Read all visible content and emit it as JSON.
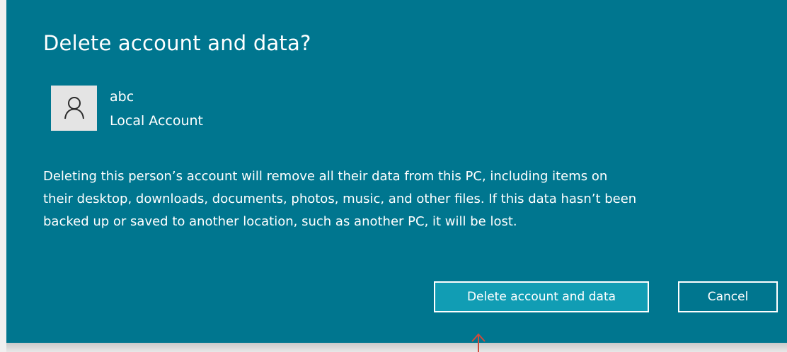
{
  "dialog": {
    "title": "Delete account and data?",
    "account": {
      "name": "abc",
      "type": "Local Account",
      "avatar_icon": "person-icon"
    },
    "message_lines": [
      "Deleting this person’s account will remove all their data from this PC, including items on",
      "their desktop, downloads, documents, photos, music, and other files. If this data hasn’t been",
      "backed up or saved to another location, such as another PC, it will be lost."
    ],
    "buttons": {
      "delete_label": "Delete account and data",
      "cancel_label": "Cancel"
    },
    "colors": {
      "background": "#00768f",
      "primary_button": "#119db4",
      "text": "#ffffff",
      "annotation_arrow": "#d04a3a"
    }
  }
}
